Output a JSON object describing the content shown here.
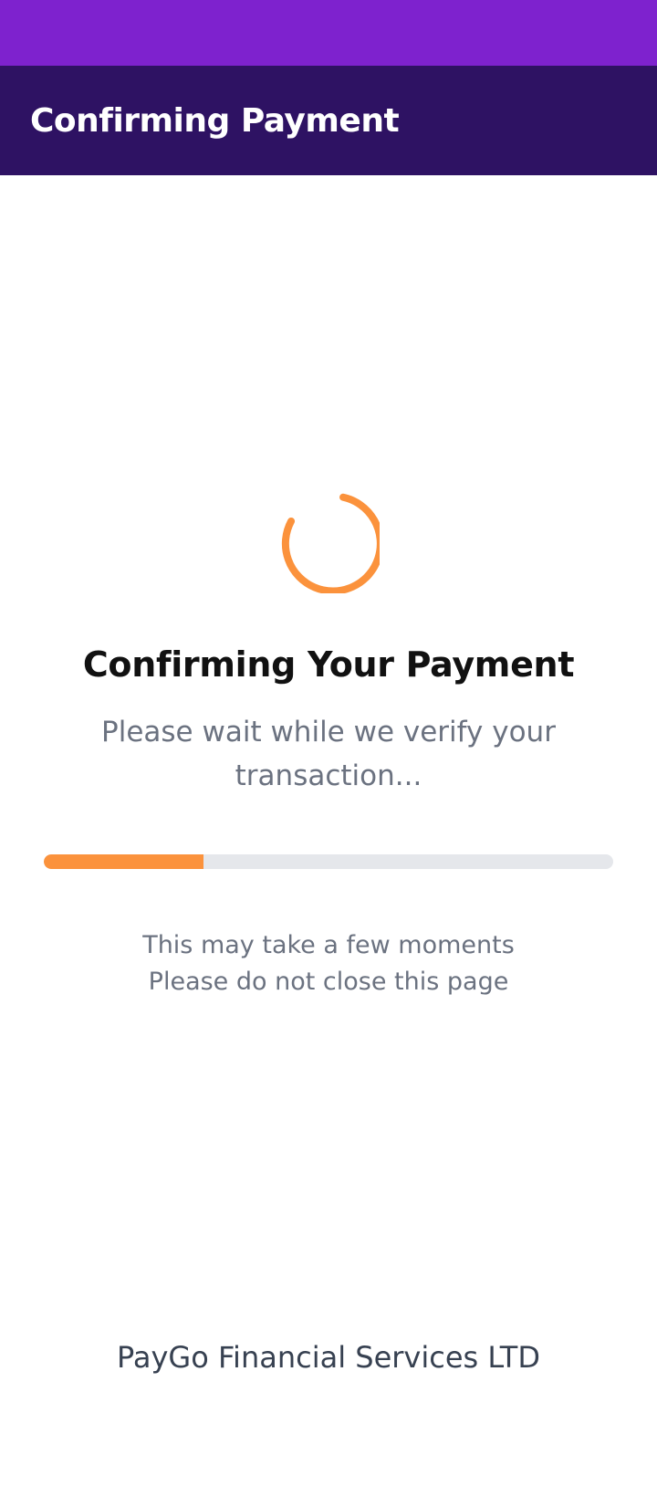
{
  "header": {
    "title": "Confirming Payment"
  },
  "status": {
    "heading": "Confirming Your Payment",
    "subtext": "Please wait while we verify your transaction...",
    "progress_percent": 28,
    "note_line_1": "This may take a few moments",
    "note_line_2": "Please do not close this page",
    "spinner_icon": "loading-spinner-icon"
  },
  "footer": {
    "company": "PayGo Financial Services LTD"
  },
  "colors": {
    "status_bar": "#7e22ce",
    "header_bg": "#2e1263",
    "accent": "#fb923c",
    "track": "#e5e7eb",
    "muted_text": "#6b7280"
  }
}
